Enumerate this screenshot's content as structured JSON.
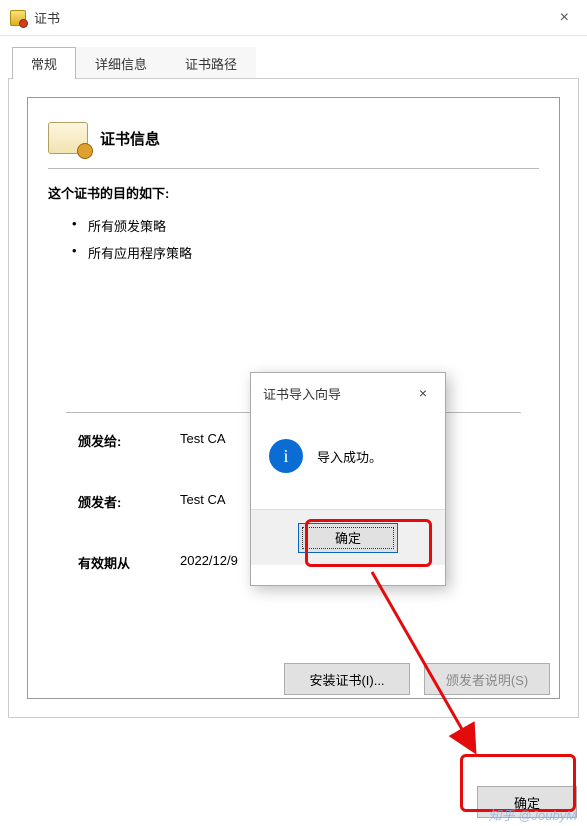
{
  "window": {
    "title": "证书",
    "close_glyph": "×"
  },
  "tabs": {
    "general": "常规",
    "details": "详细信息",
    "path": "证书路径"
  },
  "cert": {
    "info_heading": "证书信息",
    "purpose_label": "这个证书的目的如下:",
    "purposes": {
      "p0": "所有颁发策略",
      "p1": "所有应用程序策略"
    },
    "issued_to_label": "颁发给:",
    "issued_to": "Test CA",
    "issuer_label": "颁发者:",
    "issuer": "Test CA",
    "valid_from_label": "有效期从",
    "valid_from": "2022/12/9"
  },
  "buttons": {
    "install": "安装证书(I)...",
    "issuer_statement": "颁发者说明(S)",
    "ok": "确定"
  },
  "modal": {
    "title": "证书导入向导",
    "close_glyph": "×",
    "info_glyph": "i",
    "message": "导入成功。",
    "ok": "确定"
  },
  "watermark": "知乎 @JoubyM"
}
